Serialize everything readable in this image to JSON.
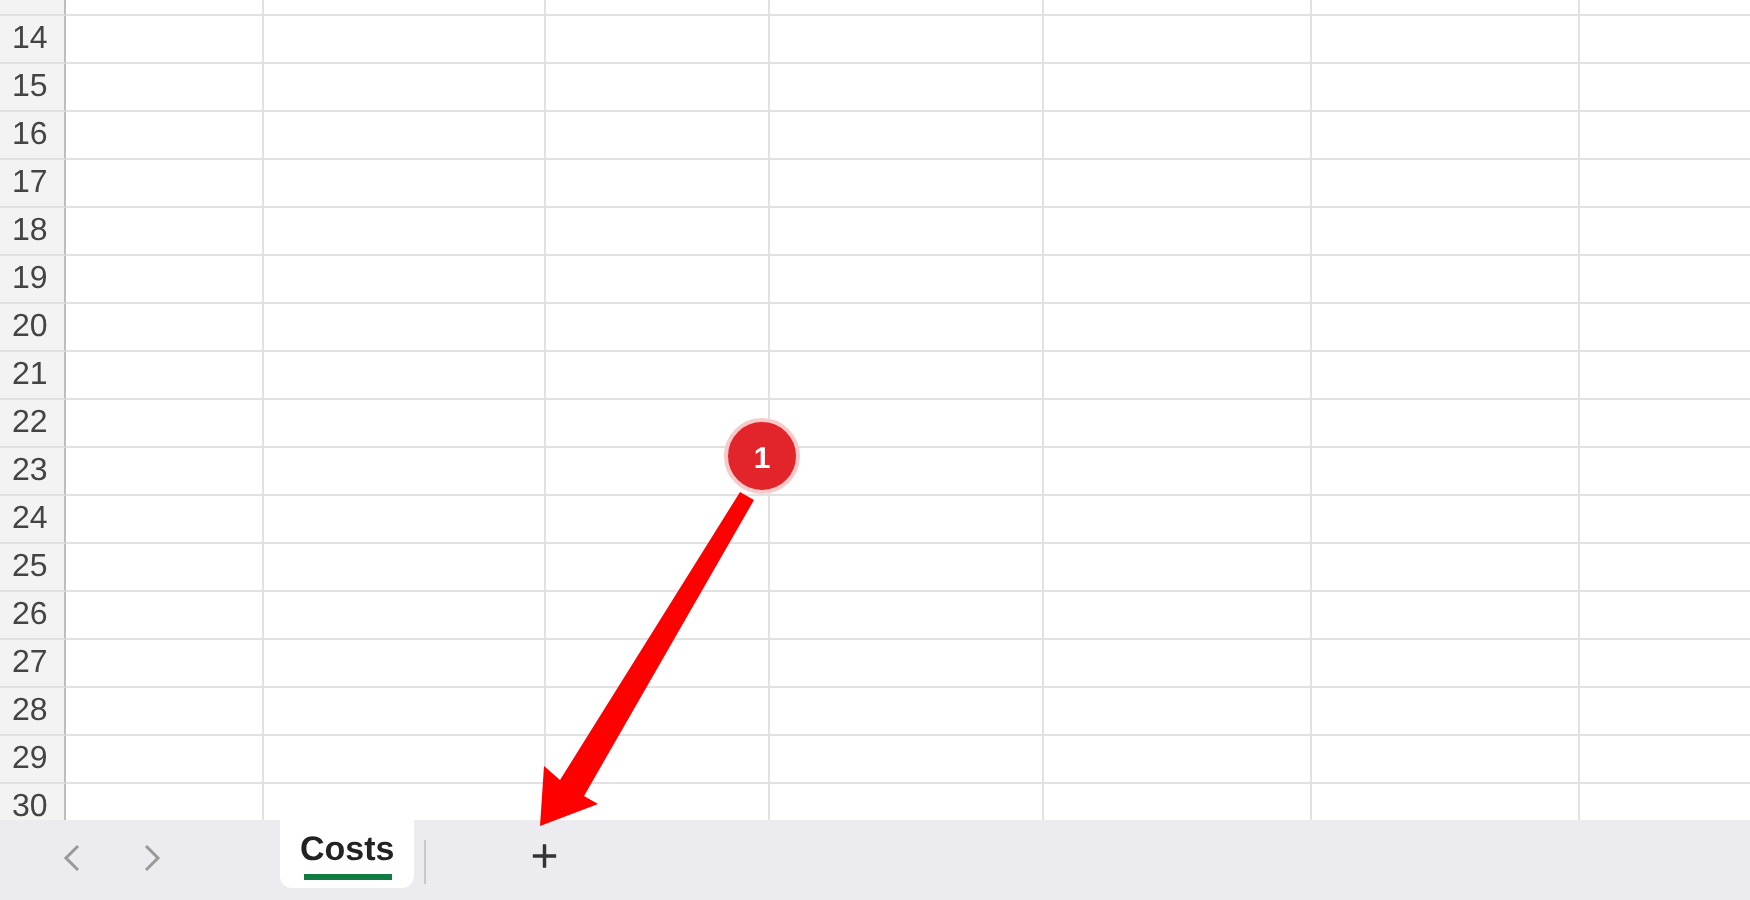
{
  "rows": [
    "14",
    "15",
    "16",
    "17",
    "18",
    "19",
    "20",
    "21",
    "22",
    "23",
    "24",
    "25",
    "26",
    "27",
    "28",
    "29",
    "30"
  ],
  "sheet_tabs": [
    {
      "label": "Costs",
      "selected": true
    }
  ],
  "new_sheet_button": {
    "label": "+"
  },
  "annotation": {
    "label": "1"
  }
}
